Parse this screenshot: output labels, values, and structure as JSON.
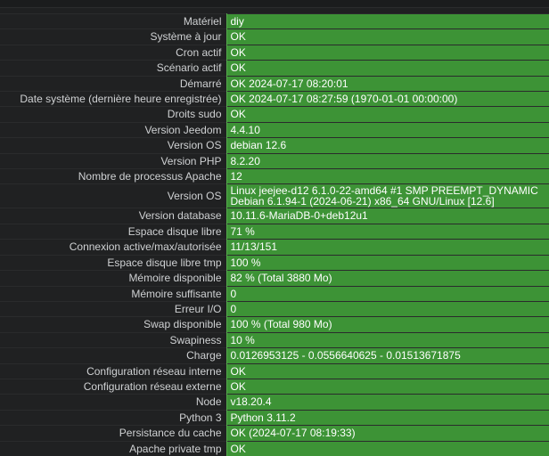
{
  "colors": {
    "background": "#1f2021",
    "label_text": "#cfd1d3",
    "ok_green": "#3d9336"
  },
  "rows": [
    {
      "label": "Matériel",
      "value": "diy"
    },
    {
      "label": "Système à jour",
      "value": "OK"
    },
    {
      "label": "Cron actif",
      "value": "OK"
    },
    {
      "label": "Scénario actif",
      "value": "OK"
    },
    {
      "label": "Démarré",
      "value": "OK 2024-07-17 08:20:01"
    },
    {
      "label": "Date système (dernière heure enregistrée)",
      "value": "OK 2024-07-17 08:27:59 (1970-01-01 00:00:00)"
    },
    {
      "label": "Droits sudo",
      "value": "OK"
    },
    {
      "label": "Version Jeedom",
      "value": "4.4.10"
    },
    {
      "label": "Version OS",
      "value": "debian 12.6"
    },
    {
      "label": "Version PHP",
      "value": "8.2.20"
    },
    {
      "label": "Nombre de processus Apache",
      "value": "12"
    },
    {
      "label": "Version OS",
      "value": "Linux jeejee-d12 6.1.0-22-amd64 #1 SMP PREEMPT_DYNAMIC Debian 6.1.94-1 (2024-06-21) x86_64 GNU/Linux [12.6]"
    },
    {
      "label": "Version database",
      "value": "10.11.6-MariaDB-0+deb12u1"
    },
    {
      "label": "Espace disque libre",
      "value": "71 %"
    },
    {
      "label": "Connexion active/max/autorisée",
      "value": "11/13/151"
    },
    {
      "label": "Espace disque libre tmp",
      "value": "100 %"
    },
    {
      "label": "Mémoire disponible",
      "value": "82 % (Total 3880 Mo)"
    },
    {
      "label": "Mémoire suffisante",
      "value": "0"
    },
    {
      "label": "Erreur I/O",
      "value": "0"
    },
    {
      "label": "Swap disponible",
      "value": "100 % (Total 980 Mo)"
    },
    {
      "label": "Swapiness",
      "value": "10 %"
    },
    {
      "label": "Charge",
      "value": "0.0126953125 - 0.0556640625 - 0.01513671875"
    },
    {
      "label": "Configuration réseau interne",
      "value": "OK"
    },
    {
      "label": "Configuration réseau externe",
      "value": "OK"
    },
    {
      "label": "Node",
      "value": "v18.20.4"
    },
    {
      "label": "Python 3",
      "value": "Python 3.11.2"
    },
    {
      "label": "Persistance du cache",
      "value": "OK (2024-07-17 08:19:33)"
    },
    {
      "label": "Apache private tmp",
      "value": "OK"
    }
  ]
}
